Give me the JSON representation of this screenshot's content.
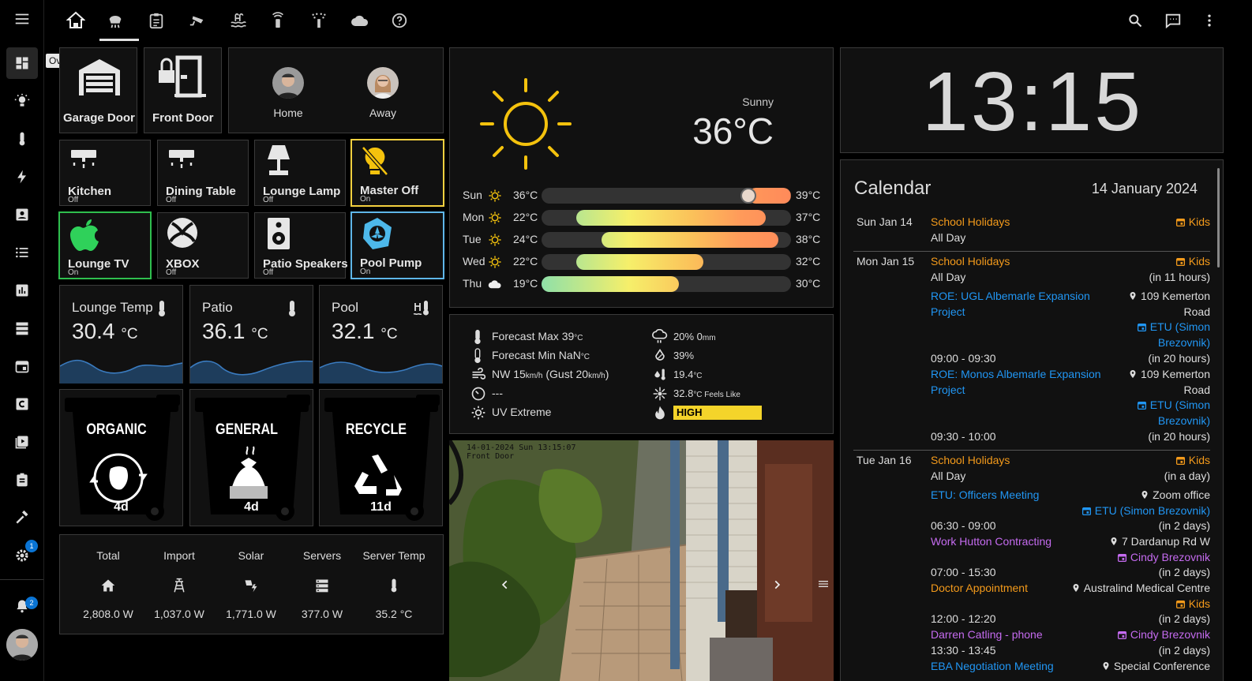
{
  "sidebar": {
    "tooltip": "Overview",
    "items": [
      {
        "name": "overview-icon"
      },
      {
        "name": "lightbulb-icon"
      },
      {
        "name": "thermometer-icon"
      },
      {
        "name": "lightning-icon"
      },
      {
        "name": "account-box-icon"
      },
      {
        "name": "list-icon"
      },
      {
        "name": "chart-icon"
      },
      {
        "name": "server-icon"
      },
      {
        "name": "calendar-icon"
      },
      {
        "name": "c-box-icon"
      },
      {
        "name": "media-icon"
      },
      {
        "name": "clipboard-icon"
      },
      {
        "name": "hammer-icon"
      },
      {
        "name": "settings-icon"
      }
    ],
    "settings_badge": "1",
    "notifications_badge": "2"
  },
  "topbar": {
    "tabs": [
      "home-icon",
      "air-purifier-icon",
      "clipboard-list-icon",
      "cctv-icon",
      "pool-icon",
      "router-icon",
      "sprinkler-icon",
      "cloud-icon",
      "help-icon"
    ]
  },
  "garage": {
    "name": "Garage Door"
  },
  "front_door": {
    "name": "Front Door"
  },
  "people": [
    {
      "name": "Home"
    },
    {
      "name": "Away"
    }
  ],
  "lights": [
    {
      "name": "Kitchen",
      "state": "Off"
    },
    {
      "name": "Dining Table",
      "state": "Off"
    },
    {
      "name": "Lounge Lamp",
      "state": "Off"
    },
    {
      "name": "Master Off",
      "state": "On"
    },
    {
      "name": "Lounge TV",
      "state": "On"
    },
    {
      "name": "XBOX",
      "state": "Off"
    },
    {
      "name": "Patio Speakers",
      "state": "Off"
    },
    {
      "name": "Pool Pump",
      "state": "On"
    }
  ],
  "temps": [
    {
      "title": "Lounge Temp",
      "value": "30.4",
      "unit": "°C"
    },
    {
      "title": "Patio",
      "value": "36.1",
      "unit": "°C"
    },
    {
      "title": "Pool",
      "value": "32.1",
      "unit": "°C"
    }
  ],
  "bins": [
    {
      "label": "ORGANIC",
      "days": "4d"
    },
    {
      "label": "GENERAL",
      "days": "4d"
    },
    {
      "label": "RECYCLE",
      "days": "11d"
    }
  ],
  "energy": {
    "headers": [
      "Total",
      "Import",
      "Solar",
      "Servers",
      "Server Temp"
    ],
    "values": [
      "2,808.0 W",
      "1,037.0 W",
      "1,771.0 W",
      "377.0 W",
      "35.2 °C"
    ]
  },
  "weather": {
    "condition": "Sunny",
    "temperature": "36°C",
    "forecast": [
      {
        "day": "Sun",
        "low": "36°C",
        "high": "39°C",
        "icon": "sun",
        "bar_from": 0.83,
        "bar_to": 1.0
      },
      {
        "day": "Mon",
        "low": "22°C",
        "high": "37°C",
        "icon": "sun",
        "bar_from": 0.14,
        "bar_to": 0.9
      },
      {
        "day": "Tue",
        "low": "24°C",
        "high": "38°C",
        "icon": "sun",
        "bar_from": 0.24,
        "bar_to": 0.95
      },
      {
        "day": "Wed",
        "low": "22°C",
        "high": "32°C",
        "icon": "sun",
        "bar_from": 0.14,
        "bar_to": 0.65
      },
      {
        "day": "Thu",
        "low": "19°C",
        "high": "30°C",
        "icon": "cloud",
        "bar_from": 0.0,
        "bar_to": 0.55
      }
    ]
  },
  "details": {
    "forecast_max": "Forecast Max 39",
    "forecast_max_unit": "°C",
    "forecast_min": "Forecast Min NaN",
    "forecast_min_unit": "°C",
    "wind_a": "NW 15",
    "wind_unit": "km/h",
    "wind_b": " (Gust 20",
    "wind_c": ")",
    "pressure": "---",
    "uv": "UV Extreme",
    "rain_pct": "20% 0",
    "rain_unit": "mm",
    "humidity": "39%",
    "dew": "19.4",
    "dew_unit": "°C",
    "feels": "32.8",
    "feels_unit": "°C Feels Like",
    "fire": "HIGH"
  },
  "camera": {
    "timestamp": "14-01-2024 Sun 13:15:07",
    "name": "Front Door"
  },
  "clock": {
    "time": "13:15"
  },
  "calendar": {
    "title": "Calendar",
    "date": "14 January 2024",
    "lines": [
      {
        "date": "Sun Jan 14"
      },
      {
        "date": "Mon Jan 15"
      },
      {
        "date": "Tue Jan 16"
      }
    ],
    "items": [
      {
        "text": "School Holidays",
        "color": "orange"
      },
      {
        "text": "All Day",
        "color": "white"
      },
      {
        "text": "School Holidays",
        "color": "orange"
      },
      {
        "text": "All Day",
        "color": "white"
      },
      {
        "text": "ROE: UGL Albemarle Expansion",
        "color": "blue"
      },
      {
        "text": "Project",
        "color": "blue"
      },
      {
        "text": "09:00 - 09:30",
        "color": "white"
      },
      {
        "text": "ROE: Monos Albemarle Expansion",
        "color": "blue"
      },
      {
        "text": "Project",
        "color": "blue"
      },
      {
        "text": "09:30 - 10:00",
        "color": "white"
      },
      {
        "text": "School Holidays",
        "color": "orange"
      },
      {
        "text": "All Day",
        "color": "white"
      },
      {
        "text": "ETU: Officers Meeting",
        "color": "blue"
      },
      {
        "text": "06:30 - 09:00",
        "color": "white"
      },
      {
        "text": "Work Hutton Contracting",
        "color": "purple"
      },
      {
        "text": "07:00 - 15:30",
        "color": "white"
      },
      {
        "text": "Doctor Appointment",
        "color": "orange"
      },
      {
        "text": "12:00 - 12:20",
        "color": "white"
      },
      {
        "text": "Darren Catling - phone",
        "color": "purple"
      },
      {
        "text": "13:30 - 13:45",
        "color": "white"
      },
      {
        "text": "EBA Negotiation Meeting",
        "color": "blue"
      }
    ],
    "right": [
      {
        "text": "Kids",
        "color": "orange",
        "icon": true
      },
      {
        "text": "Kids",
        "color": "orange",
        "icon": true
      },
      {
        "text": "(in 11 hours)",
        "color": "white"
      },
      {
        "text": "109 Kemerton",
        "color": "white",
        "pin": true
      },
      {
        "text": "Road",
        "color": "white"
      },
      {
        "text": "ETU (Simon",
        "color": "blue",
        "icon": true
      },
      {
        "text": "Brezovnik)",
        "color": "blue"
      },
      {
        "text": "(in 20 hours)",
        "color": "white"
      },
      {
        "text": "109 Kemerton",
        "color": "white",
        "pin": true
      },
      {
        "text": "Road",
        "color": "white"
      },
      {
        "text": "ETU (Simon",
        "color": "blue",
        "icon": true
      },
      {
        "text": "Brezovnik)",
        "color": "blue"
      },
      {
        "text": "(in 20 hours)",
        "color": "white"
      },
      {
        "text": "Kids",
        "color": "orange",
        "icon": true
      },
      {
        "text": "(in a day)",
        "color": "white"
      },
      {
        "text": "Zoom office",
        "color": "white",
        "pin": true
      },
      {
        "text": "ETU (Simon Brezovnik)",
        "color": "blue",
        "icon": true
      },
      {
        "text": "(in 2 days)",
        "color": "white"
      },
      {
        "text": "7 Dardanup Rd W",
        "color": "white",
        "pin": true
      },
      {
        "text": "Cindy Brezovnik",
        "color": "purple",
        "icon": true
      },
      {
        "text": "(in 2 days)",
        "color": "white"
      },
      {
        "text": "Australind Medical Centre",
        "color": "white",
        "pin": true
      },
      {
        "text": "Kids",
        "color": "orange",
        "icon": true
      },
      {
        "text": "(in 2 days)",
        "color": "white"
      },
      {
        "text": "Cindy Brezovnik",
        "color": "purple",
        "icon": true
      },
      {
        "text": "(in 2 days)",
        "color": "white"
      },
      {
        "text": "Special Conference",
        "color": "white",
        "pin": true
      }
    ]
  }
}
